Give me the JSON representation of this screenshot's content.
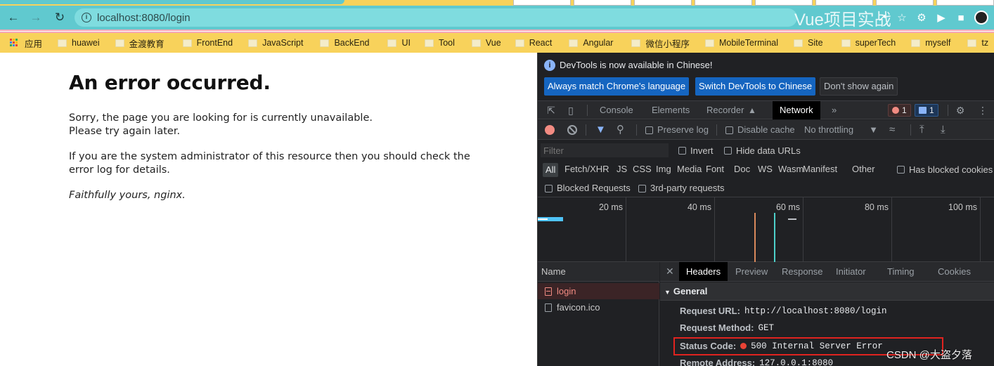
{
  "browser": {
    "url": "localhost:8080/login",
    "overlay_title": "Vue项目实战",
    "bookmarks": [
      {
        "label": "应用",
        "type": "apps"
      },
      {
        "label": "huawei",
        "type": "folder"
      },
      {
        "label": "金渡教育",
        "type": "folder"
      },
      {
        "label": "FrontEnd",
        "type": "folder"
      },
      {
        "label": "JavaScript",
        "type": "folder"
      },
      {
        "label": "BackEnd",
        "type": "folder"
      },
      {
        "label": "UI",
        "type": "folder"
      },
      {
        "label": "Tool",
        "type": "folder"
      },
      {
        "label": "Vue",
        "type": "folder"
      },
      {
        "label": "React",
        "type": "folder"
      },
      {
        "label": "Angular",
        "type": "folder"
      },
      {
        "label": "微信小程序",
        "type": "folder"
      },
      {
        "label": "MobileTerminal",
        "type": "folder"
      },
      {
        "label": "Site",
        "type": "folder"
      },
      {
        "label": "superTech",
        "type": "folder"
      },
      {
        "label": "myself",
        "type": "folder"
      },
      {
        "label": "tz",
        "type": "folder"
      }
    ]
  },
  "page": {
    "heading": "An error occurred.",
    "p1_line1": "Sorry, the page you are looking for is currently unavailable.",
    "p1_line2": "Please try again later.",
    "p2_line1": "If you are the system administrator of this resource then you should check the",
    "p2_line2": "error log for details.",
    "signature": "Faithfully yours, nginx."
  },
  "devtools": {
    "info_message": "DevTools is now available in Chinese!",
    "btn_match": "Always match Chrome's language",
    "btn_switch": "Switch DevTools to Chinese",
    "btn_dismiss": "Don't show again",
    "tabs": {
      "console": "Console",
      "elements": "Elements",
      "recorder": "Recorder",
      "network": "Network",
      "more": "»"
    },
    "error_count": "1",
    "message_count": "1",
    "toolbar": {
      "preserve_log": "Preserve log",
      "disable_cache": "Disable cache",
      "throttling": "No throttling"
    },
    "filter": {
      "placeholder": "Filter",
      "invert": "Invert",
      "hide_data_urls": "Hide data URLs"
    },
    "types": [
      "All",
      "Fetch/XHR",
      "JS",
      "CSS",
      "Img",
      "Media",
      "Font",
      "Doc",
      "WS",
      "Wasm",
      "Manifest",
      "Other"
    ],
    "has_blocked_cookies": "Has blocked cookies",
    "blocked_requests": "Blocked Requests",
    "third_party": "3rd-party requests",
    "timeline_ticks": [
      "20 ms",
      "40 ms",
      "60 ms",
      "80 ms",
      "100 ms"
    ],
    "name_header": "Name",
    "requests": [
      {
        "name": "login",
        "status": "error"
      },
      {
        "name": "favicon.ico",
        "status": "ok"
      }
    ],
    "detail_tabs": [
      "Headers",
      "Preview",
      "Response",
      "Initiator",
      "Timing",
      "Cookies"
    ],
    "general_title": "General",
    "request_url_key": "Request URL:",
    "request_url_val": "http://localhost:8080/login",
    "request_method_key": "Request Method:",
    "request_method_val": "GET",
    "status_code_key": "Status Code:",
    "status_code_val": "500 Internal Server Error",
    "remote_address_key": "Remote Address:",
    "remote_address_val": "127.0.0.1:8080"
  },
  "watermark": "CSDN @大盗夕落",
  "colors": {
    "tab_bar": "#60c9cf",
    "bookmarks_bar": "#f8d25b",
    "devtools_bg": "#202124",
    "error_red": "#ea4335",
    "highlight_box": "#e0231f"
  }
}
